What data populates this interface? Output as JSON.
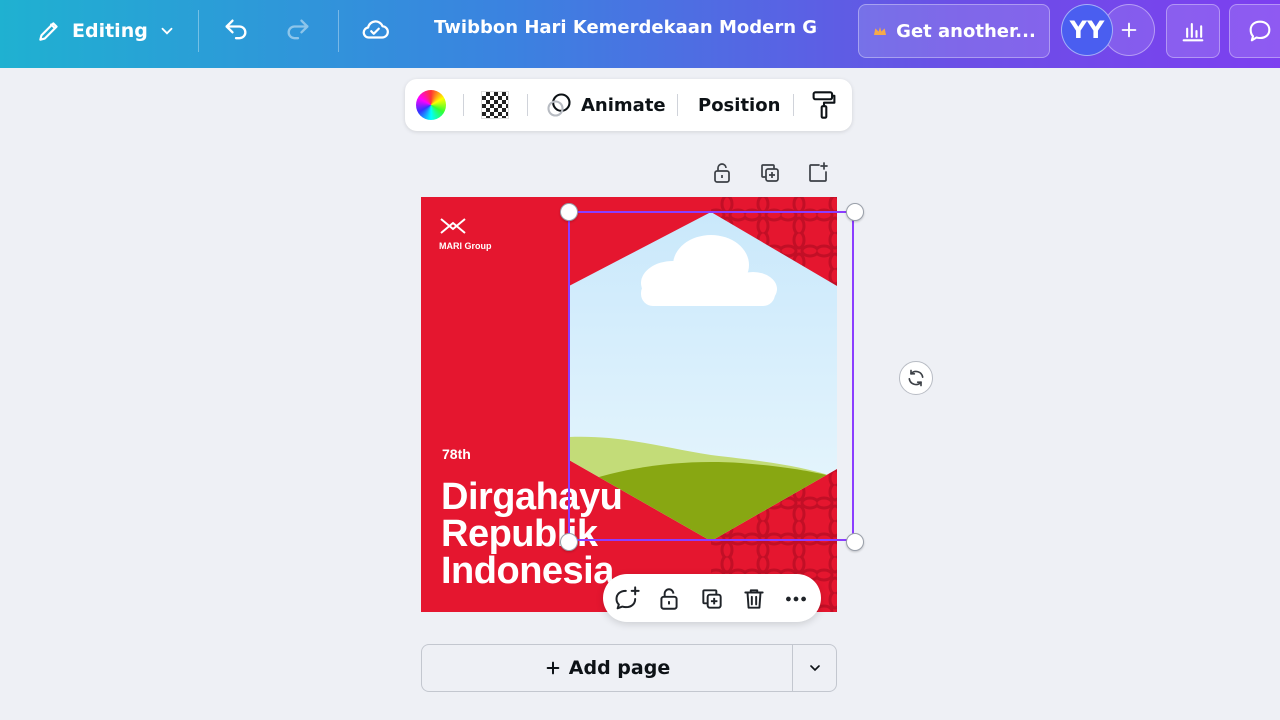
{
  "header": {
    "mode_label": "Editing",
    "document_title": "Twibbon Hari Kemerdekaan Modern Geo...",
    "upgrade_label": "Get another...",
    "avatar_initials": "YY"
  },
  "element_toolbar": {
    "animate_label": "Animate",
    "position_label": "Position"
  },
  "design": {
    "logo_text": "MARI Group",
    "small_label": "78th",
    "headline_lines": [
      "Dirgahayu",
      "Republik",
      "Indonesia"
    ],
    "colors": {
      "background": "#e5162f",
      "pattern": "#c20f26",
      "sky_top": "#c9e8fb",
      "sky_bottom": "#eaf7fd",
      "hill_light": "#c3dc78",
      "hill_dark": "#88a712",
      "cloud": "#ffffff"
    }
  },
  "selection": {
    "accent": "#8b3dff"
  },
  "footer": {
    "add_page_label": "Add page"
  }
}
